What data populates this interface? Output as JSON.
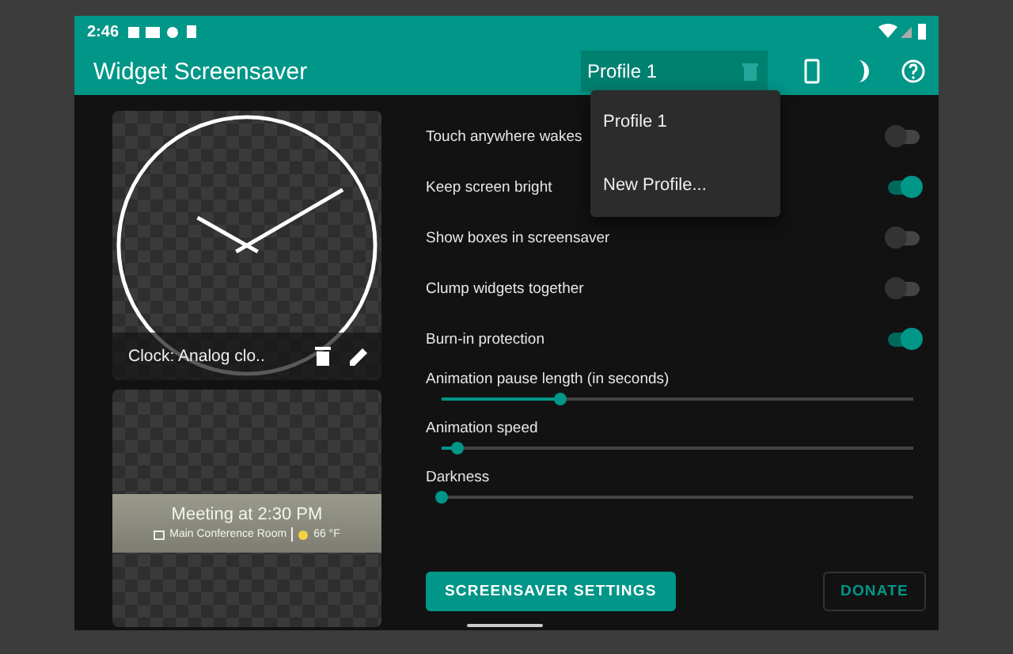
{
  "status_bar": {
    "time": "2:46"
  },
  "app_bar": {
    "title": "Widget Screensaver",
    "profile": "Profile 1"
  },
  "profile_menu": {
    "open": true,
    "items": [
      "Profile 1",
      "New Profile..."
    ]
  },
  "widgets": [
    {
      "kind": "clock",
      "caption": "Clock: Analog clo.."
    },
    {
      "kind": "calendar",
      "title": "Meeting at 2:30 PM",
      "location": "Main Conference Room",
      "temperature": "66 °F"
    }
  ],
  "settings": [
    {
      "kind": "switch",
      "label": "Touch anywhere wakes",
      "on": false
    },
    {
      "kind": "switch",
      "label": "Keep screen bright",
      "on": true
    },
    {
      "kind": "switch",
      "label": "Show boxes in screensaver",
      "on": false
    },
    {
      "kind": "switch",
      "label": "Clump widgets together",
      "on": false
    },
    {
      "kind": "switch",
      "label": "Burn-in protection",
      "on": true
    },
    {
      "kind": "slider",
      "label": "Animation pause length (in seconds)",
      "level": 0.25
    },
    {
      "kind": "slider",
      "label": "Animation speed",
      "level": 0.035
    },
    {
      "kind": "slider",
      "label": "Darkness",
      "level": 0
    }
  ],
  "buttons": {
    "primary": "SCREENSAVER SETTINGS",
    "secondary": "DONATE"
  }
}
